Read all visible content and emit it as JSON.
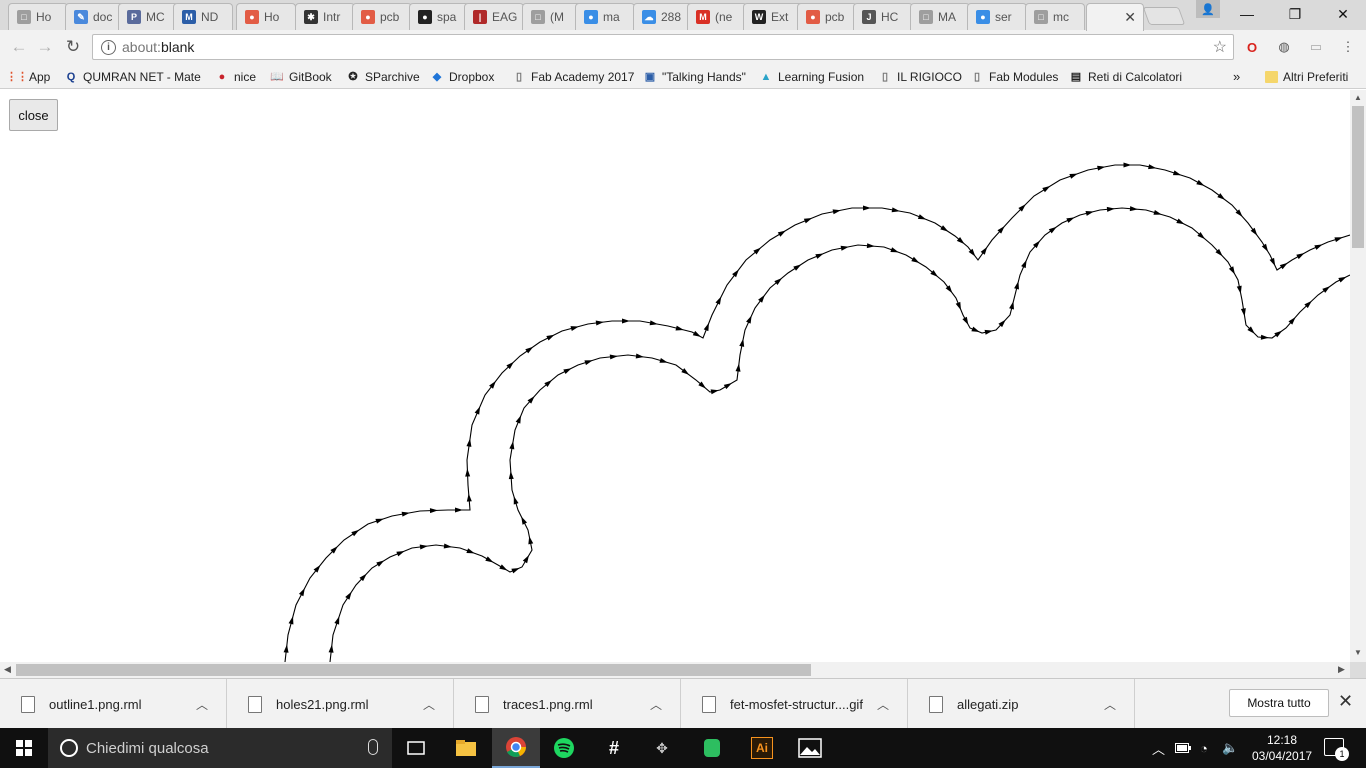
{
  "tabs": [
    {
      "title": "Ho",
      "color": "#9e9e9e",
      "glyph": "□"
    },
    {
      "title": "doc",
      "color": "#4a89dc",
      "glyph": "✎"
    },
    {
      "title": "MC",
      "color": "#5a6b9c",
      "glyph": "P"
    },
    {
      "title": "ND",
      "color": "#2c5ea8",
      "glyph": "M"
    },
    {
      "title": "Ho",
      "color": "#e25c45",
      "glyph": "●"
    },
    {
      "title": "Intr",
      "color": "#333333",
      "glyph": "✱"
    },
    {
      "title": "pcb",
      "color": "#e25c45",
      "glyph": "●"
    },
    {
      "title": "spa",
      "color": "#222222",
      "glyph": "●"
    },
    {
      "title": "EAG",
      "color": "#b02a2a",
      "glyph": "|"
    },
    {
      "title": "(M",
      "color": "#9e9e9e",
      "glyph": "□"
    },
    {
      "title": "ma",
      "color": "#3a8ee6",
      "glyph": "●"
    },
    {
      "title": "288",
      "color": "#3a8ee6",
      "glyph": "☁"
    },
    {
      "title": "(ne",
      "color": "#d93025",
      "glyph": "M"
    },
    {
      "title": "Ext",
      "color": "#222222",
      "glyph": "W"
    },
    {
      "title": "pcb",
      "color": "#e25c45",
      "glyph": "●"
    },
    {
      "title": "HC",
      "color": "#555555",
      "glyph": "J"
    },
    {
      "title": "MA",
      "color": "#9e9e9e",
      "glyph": "□"
    },
    {
      "title": "ser",
      "color": "#3a8ee6",
      "glyph": "●"
    },
    {
      "title": "mc",
      "color": "#9e9e9e",
      "glyph": "□"
    },
    {
      "title": "",
      "color": "#ffffff",
      "glyph": ""
    }
  ],
  "active_tab_close": "✕",
  "window_controls": {
    "minimize": "—",
    "maximize": "❐",
    "close": "✕"
  },
  "address": {
    "scheme": "about:",
    "path": "blank"
  },
  "bookmarks": [
    {
      "label": "App",
      "icon": "apps-grid-icon",
      "glyph": "⋮⋮",
      "color": "#e0522b"
    },
    {
      "label": "QUMRAN NET - Mate",
      "icon": "qumran-icon",
      "glyph": "Q",
      "color": "#1a3f8f"
    },
    {
      "label": "nice",
      "icon": "pinterest-icon",
      "glyph": "●",
      "color": "#c8232c"
    },
    {
      "label": "GitBook",
      "icon": "gitbook-icon",
      "glyph": "📖",
      "color": "#333333"
    },
    {
      "label": "SParchive",
      "icon": "sparchive-icon",
      "glyph": "✪",
      "color": "#222222"
    },
    {
      "label": "Dropbox",
      "icon": "dropbox-icon",
      "glyph": "◆",
      "color": "#1f75d8"
    },
    {
      "label": "Fab Academy 2017",
      "icon": "page-icon",
      "glyph": "▯",
      "color": "#777777"
    },
    {
      "label": "\"Talking Hands\"",
      "icon": "talking-hands-icon",
      "glyph": "▣",
      "color": "#2c5ea8"
    },
    {
      "label": "Learning Fusion",
      "icon": "fusion-icon",
      "glyph": "▲",
      "color": "#2aa3c8"
    },
    {
      "label": "IL RIGIOCO",
      "icon": "page-icon",
      "glyph": "▯",
      "color": "#777777"
    },
    {
      "label": "Fab Modules",
      "icon": "page-icon",
      "glyph": "▯",
      "color": "#777777"
    },
    {
      "label": "Reti di Calcolatori",
      "icon": "reti-icon",
      "glyph": "▤",
      "color": "#222222"
    }
  ],
  "bookmarks_overflow": "»",
  "other_bookmarks": "Altri Preferiti",
  "page": {
    "close_label": "close"
  },
  "downloads": [
    {
      "name": "outline1.png.rml",
      "chevron": "︿"
    },
    {
      "name": "holes21.png.rml",
      "chevron": "︿"
    },
    {
      "name": "traces1.png.rml",
      "chevron": "︿"
    },
    {
      "name": "fet-mosfet-structur....gif",
      "chevron": "︿"
    },
    {
      "name": "allegati.zip",
      "chevron": "︿"
    }
  ],
  "show_all": "Mostra tutto",
  "downloads_close": "✕",
  "taskbar": {
    "search_placeholder": "Chiedimi qualcosa",
    "time": "12:18",
    "date": "03/04/2017",
    "notifications": "1"
  }
}
